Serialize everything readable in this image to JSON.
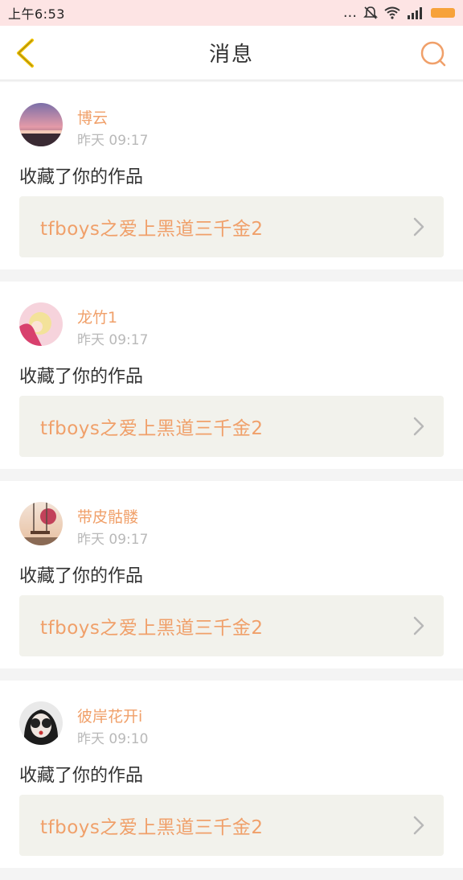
{
  "status_bar": {
    "time": "上午6:53",
    "more": "..."
  },
  "nav": {
    "title": "消息"
  },
  "colors": {
    "accent": "#f0a06a",
    "status_bar_bg": "#fde4e4",
    "battery": "#f7a23a",
    "back_arrow": "#f2c300"
  },
  "notifications": [
    {
      "username": "博云",
      "time": "昨天 09:17",
      "action": "收藏了你的作品",
      "work_title": "tfboys之爱上黑道三千金2",
      "avatar": "sunset-landscape"
    },
    {
      "username": "龙竹1",
      "time": "昨天 09:17",
      "action": "收藏了你的作品",
      "work_title": "tfboys之爱上黑道三千金2",
      "avatar": "pink-anime-girl"
    },
    {
      "username": "带皮骷髅",
      "time": "昨天 09:17",
      "action": "收藏了你的作品",
      "work_title": "tfboys之爱上黑道三千金2",
      "avatar": "swing-scene"
    },
    {
      "username": "彼岸花开i",
      "time": "昨天 09:10",
      "action": "收藏了你的作品",
      "work_title": "tfboys之爱上黑道三千金2",
      "avatar": "girl-with-sunglasses"
    }
  ]
}
